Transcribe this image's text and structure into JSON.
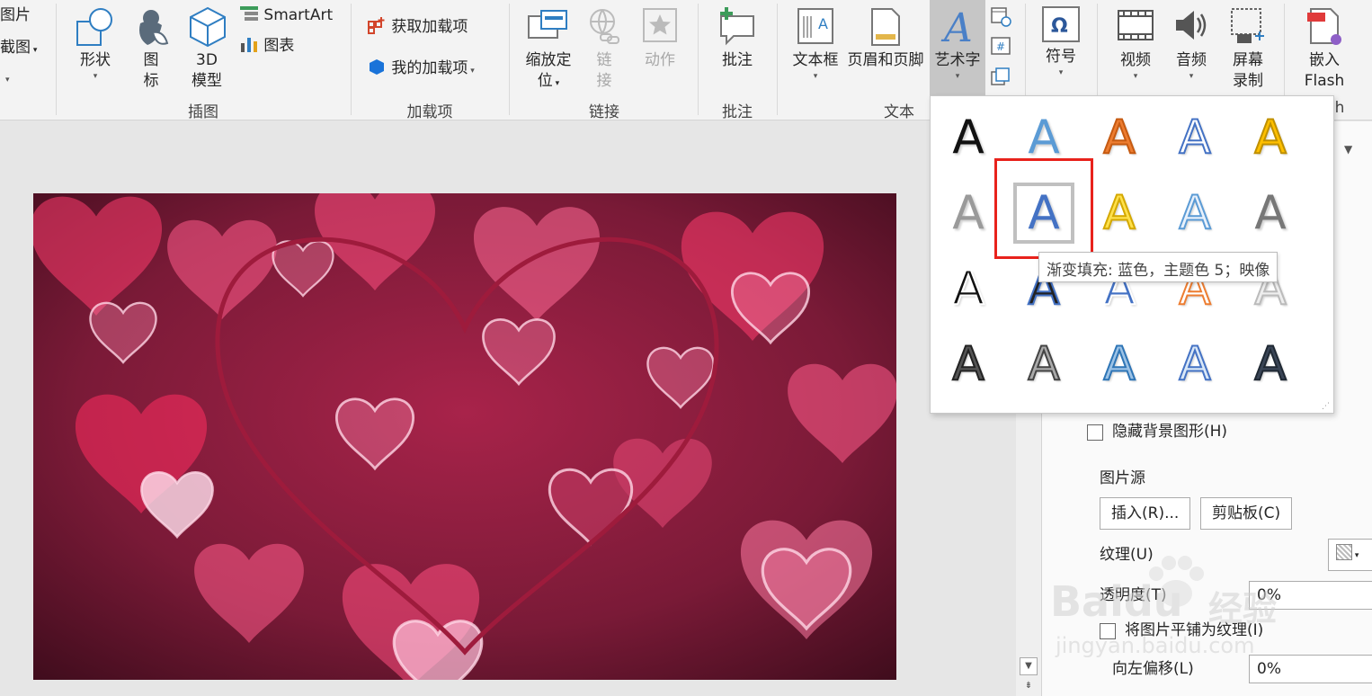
{
  "ribbon": {
    "partial_left": {
      "picture": "图片",
      "screenshot": "截图"
    },
    "illustrations": {
      "shapes": "形状",
      "icons_l1": "图",
      "icons_l2": "标",
      "model_l1": "3D",
      "model_l2": "模型",
      "smartart": "SmartArt",
      "chart": "图表",
      "group": "插图"
    },
    "addins": {
      "get": "获取加载项",
      "mine": "我的加载项",
      "group": "加载项"
    },
    "links": {
      "zoom_l1": "缩放定",
      "zoom_l2": "位",
      "link_l1": "链",
      "link_l2": "接",
      "action": "动作",
      "group": "链接"
    },
    "comments": {
      "comment": "批注",
      "group": "批注"
    },
    "text": {
      "textbox": "文本框",
      "header_footer": "页眉和页脚",
      "wordart": "艺术字",
      "group": "文本"
    },
    "symbols": {
      "symbol": "符号"
    },
    "media": {
      "video": "视频",
      "audio": "音频",
      "rec_l1": "屏幕",
      "rec_l2": "录制"
    },
    "flash": {
      "l1": "嵌入",
      "l2": "Flash",
      "group_partial": "h"
    }
  },
  "wordart_gallery": {
    "styles": [
      {
        "glyph": "A",
        "fill": "#111111",
        "stroke": "none"
      },
      {
        "glyph": "A",
        "fill": "#5b9bd5",
        "stroke": "none"
      },
      {
        "glyph": "A",
        "fill": "#ed7d31",
        "stroke": "#c55a11"
      },
      {
        "glyph": "A",
        "fill": "#ffffff",
        "stroke": "#4472c4"
      },
      {
        "glyph": "A",
        "fill": "#ffc000",
        "stroke": "#bf9000"
      },
      {
        "glyph": "A",
        "fill": "#9a9a9a",
        "stroke": "none"
      },
      {
        "glyph": "A",
        "fill": "#4472c4",
        "stroke": "none"
      },
      {
        "glyph": "A",
        "fill": "#ffe14d",
        "stroke": "#d4a800"
      },
      {
        "glyph": "A",
        "fill": "#e9f1fb",
        "stroke": "#5b9bd5"
      },
      {
        "glyph": "A",
        "fill": "#777777",
        "stroke": "none"
      },
      {
        "glyph": "A",
        "fill": "#111111",
        "stroke": "#ffffff"
      },
      {
        "glyph": "A",
        "fill": "#222222",
        "stroke": "#4472c4"
      },
      {
        "glyph": "A",
        "fill": "#4472c4",
        "stroke": "#ffffff"
      },
      {
        "glyph": "A",
        "fill": "#ffffff",
        "stroke": "#ed7d31"
      },
      {
        "glyph": "A",
        "fill": "#eeeeee",
        "stroke": "#bbbbbb"
      },
      {
        "glyph": "A",
        "fill": "#555555",
        "stroke": "#222222"
      },
      {
        "glyph": "A",
        "fill": "#aaaaaa",
        "stroke": "#444444"
      },
      {
        "glyph": "A",
        "fill": "#9dc3e6",
        "stroke": "#2e75b6"
      },
      {
        "glyph": "A",
        "fill": "#dae8f7",
        "stroke": "#4472c4"
      },
      {
        "glyph": "A",
        "fill": "#3a4556",
        "stroke": "#1f2833"
      }
    ],
    "tooltip": "渐变填充: 蓝色，主题色 5；映像"
  },
  "format_pane": {
    "hide_bg": "隐藏背景图形(H)",
    "picture_source": "图片源",
    "insert": "插入(R)...",
    "clipboard": "剪贴板(C)",
    "texture": "纹理(U)",
    "transparency": "透明度(T)",
    "transparency_value": "0%",
    "tile": "将图片平铺为纹理(I)",
    "offset_left": "向左偏移(L)",
    "offset_left_value": "0%"
  },
  "watermark": {
    "brand": "Baidu",
    "cn": "经验",
    "url": "jingyan.baidu.com"
  },
  "colors": {
    "accent": "#2b579a",
    "highlight": "#e8221c"
  }
}
